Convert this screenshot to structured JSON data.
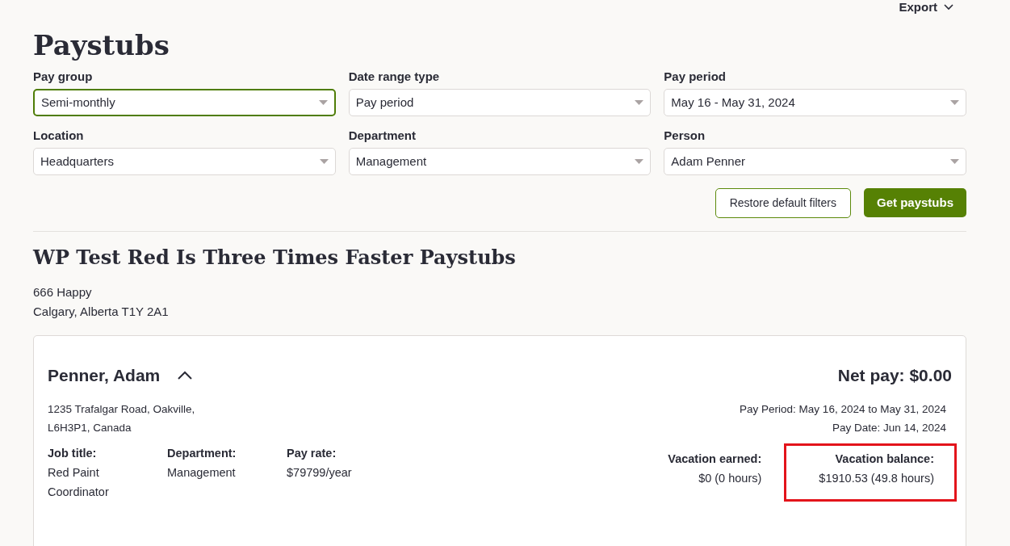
{
  "header": {
    "export_menu": "Export"
  },
  "title": "Paystubs",
  "filters": [
    {
      "label": "Pay group",
      "value": "Semi-monthly",
      "focused": true
    },
    {
      "label": "Date range type",
      "value": "Pay period",
      "focused": false
    },
    {
      "label": "Pay period",
      "value": "May 16 - May 31, 2024",
      "focused": false
    },
    {
      "label": "Location",
      "value": "Headquarters",
      "focused": false
    },
    {
      "label": "Department",
      "value": "Management",
      "focused": false
    },
    {
      "label": "Person",
      "value": "Adam Penner",
      "focused": false
    }
  ],
  "buttons": {
    "restore": "Restore default filters",
    "submit": "Get paystubs"
  },
  "company": {
    "title": "WP Test Red Is Three Times Faster Paystubs",
    "address_lines": [
      "666 Happy",
      "Calgary, Alberta T1Y 2A1"
    ]
  },
  "paystub": {
    "name": "Penner, Adam",
    "expanded": true,
    "net_pay": "Net pay: $0.00",
    "address_lines": [
      "1235 Trafalgar Road, Oakville,",
      "L6H3P1, Canada"
    ],
    "period_lines": [
      "Pay Period: May 16, 2024 to May 31, 2024",
      "Pay Date: Jun 14, 2024"
    ],
    "details": [
      {
        "label": "Job title:",
        "value_lines": [
          "Red Paint",
          "Coordinator"
        ]
      },
      {
        "label": "Department:",
        "value_lines": [
          "Management"
        ]
      },
      {
        "label": "Pay rate:",
        "value_lines": [
          "$79799/year"
        ]
      }
    ],
    "vacation": [
      {
        "label": "Vacation earned:",
        "value": "$0 (0 hours)",
        "highlighted": false
      },
      {
        "label": "Vacation balance:",
        "value": "$1910.53 (49.8 hours)",
        "highlighted": true
      }
    ]
  }
}
